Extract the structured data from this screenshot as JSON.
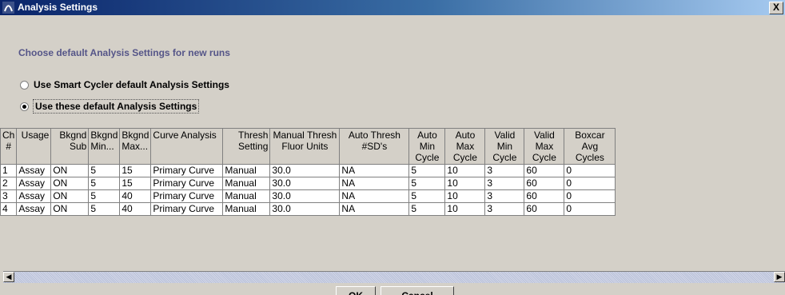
{
  "window": {
    "title": "Analysis Settings",
    "close_label": "X"
  },
  "settings": {
    "section_title": "Choose default Analysis Settings for new runs",
    "options": [
      {
        "label": "Use Smart Cycler default Analysis Settings",
        "selected": false
      },
      {
        "label": "Use these default Analysis Settings",
        "selected": true
      }
    ]
  },
  "table": {
    "headers": [
      "Ch #",
      "Usage",
      "Bkgnd Sub",
      "Bkgnd Min...",
      "Bkgnd Max...",
      "Curve Analysis",
      "Thresh Setting",
      "Manual Thresh Fluor Units",
      "Auto Thresh #SD's",
      "Auto Min Cycle",
      "Auto Max Cycle",
      "Valid Min Cycle",
      "Valid Max Cycle",
      "Boxcar Avg Cycles"
    ],
    "rows": [
      [
        "1",
        "Assay",
        "ON",
        "5",
        "15",
        "Primary Curve",
        "Manual",
        "30.0",
        "NA",
        "5",
        "10",
        "3",
        "60",
        "0"
      ],
      [
        "2",
        "Assay",
        "ON",
        "5",
        "15",
        "Primary Curve",
        "Manual",
        "30.0",
        "NA",
        "5",
        "10",
        "3",
        "60",
        "0"
      ],
      [
        "3",
        "Assay",
        "ON",
        "5",
        "40",
        "Primary Curve",
        "Manual",
        "30.0",
        "NA",
        "5",
        "10",
        "3",
        "60",
        "0"
      ],
      [
        "4",
        "Assay",
        "ON",
        "5",
        "40",
        "Primary Curve",
        "Manual",
        "30.0",
        "NA",
        "5",
        "10",
        "3",
        "60",
        "0"
      ]
    ]
  },
  "buttons": {
    "ok": "OK",
    "cancel": "Cancel"
  }
}
